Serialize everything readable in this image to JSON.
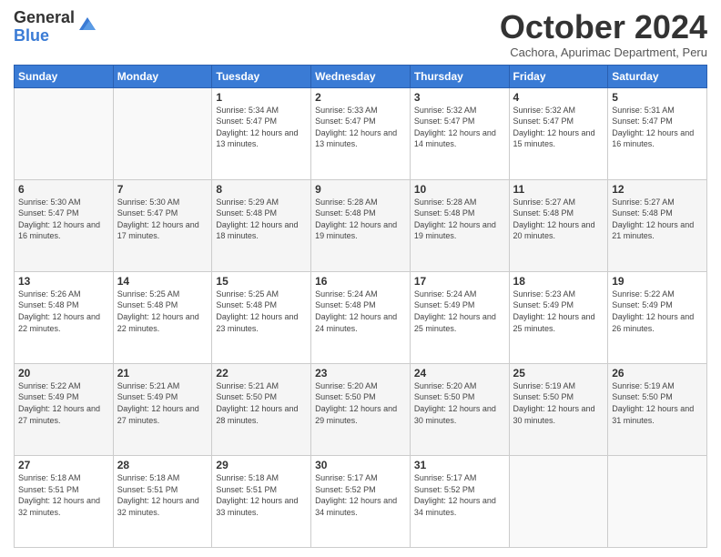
{
  "logo": {
    "general": "General",
    "blue": "Blue"
  },
  "header": {
    "month": "October 2024",
    "location": "Cachora, Apurimac Department, Peru"
  },
  "weekdays": [
    "Sunday",
    "Monday",
    "Tuesday",
    "Wednesday",
    "Thursday",
    "Friday",
    "Saturday"
  ],
  "weeks": [
    [
      {
        "day": "",
        "info": ""
      },
      {
        "day": "",
        "info": ""
      },
      {
        "day": "1",
        "info": "Sunrise: 5:34 AM\nSunset: 5:47 PM\nDaylight: 12 hours and 13 minutes."
      },
      {
        "day": "2",
        "info": "Sunrise: 5:33 AM\nSunset: 5:47 PM\nDaylight: 12 hours and 13 minutes."
      },
      {
        "day": "3",
        "info": "Sunrise: 5:32 AM\nSunset: 5:47 PM\nDaylight: 12 hours and 14 minutes."
      },
      {
        "day": "4",
        "info": "Sunrise: 5:32 AM\nSunset: 5:47 PM\nDaylight: 12 hours and 15 minutes."
      },
      {
        "day": "5",
        "info": "Sunrise: 5:31 AM\nSunset: 5:47 PM\nDaylight: 12 hours and 16 minutes."
      }
    ],
    [
      {
        "day": "6",
        "info": "Sunrise: 5:30 AM\nSunset: 5:47 PM\nDaylight: 12 hours and 16 minutes."
      },
      {
        "day": "7",
        "info": "Sunrise: 5:30 AM\nSunset: 5:47 PM\nDaylight: 12 hours and 17 minutes."
      },
      {
        "day": "8",
        "info": "Sunrise: 5:29 AM\nSunset: 5:48 PM\nDaylight: 12 hours and 18 minutes."
      },
      {
        "day": "9",
        "info": "Sunrise: 5:28 AM\nSunset: 5:48 PM\nDaylight: 12 hours and 19 minutes."
      },
      {
        "day": "10",
        "info": "Sunrise: 5:28 AM\nSunset: 5:48 PM\nDaylight: 12 hours and 19 minutes."
      },
      {
        "day": "11",
        "info": "Sunrise: 5:27 AM\nSunset: 5:48 PM\nDaylight: 12 hours and 20 minutes."
      },
      {
        "day": "12",
        "info": "Sunrise: 5:27 AM\nSunset: 5:48 PM\nDaylight: 12 hours and 21 minutes."
      }
    ],
    [
      {
        "day": "13",
        "info": "Sunrise: 5:26 AM\nSunset: 5:48 PM\nDaylight: 12 hours and 22 minutes."
      },
      {
        "day": "14",
        "info": "Sunrise: 5:25 AM\nSunset: 5:48 PM\nDaylight: 12 hours and 22 minutes."
      },
      {
        "day": "15",
        "info": "Sunrise: 5:25 AM\nSunset: 5:48 PM\nDaylight: 12 hours and 23 minutes."
      },
      {
        "day": "16",
        "info": "Sunrise: 5:24 AM\nSunset: 5:48 PM\nDaylight: 12 hours and 24 minutes."
      },
      {
        "day": "17",
        "info": "Sunrise: 5:24 AM\nSunset: 5:49 PM\nDaylight: 12 hours and 25 minutes."
      },
      {
        "day": "18",
        "info": "Sunrise: 5:23 AM\nSunset: 5:49 PM\nDaylight: 12 hours and 25 minutes."
      },
      {
        "day": "19",
        "info": "Sunrise: 5:22 AM\nSunset: 5:49 PM\nDaylight: 12 hours and 26 minutes."
      }
    ],
    [
      {
        "day": "20",
        "info": "Sunrise: 5:22 AM\nSunset: 5:49 PM\nDaylight: 12 hours and 27 minutes."
      },
      {
        "day": "21",
        "info": "Sunrise: 5:21 AM\nSunset: 5:49 PM\nDaylight: 12 hours and 27 minutes."
      },
      {
        "day": "22",
        "info": "Sunrise: 5:21 AM\nSunset: 5:50 PM\nDaylight: 12 hours and 28 minutes."
      },
      {
        "day": "23",
        "info": "Sunrise: 5:20 AM\nSunset: 5:50 PM\nDaylight: 12 hours and 29 minutes."
      },
      {
        "day": "24",
        "info": "Sunrise: 5:20 AM\nSunset: 5:50 PM\nDaylight: 12 hours and 30 minutes."
      },
      {
        "day": "25",
        "info": "Sunrise: 5:19 AM\nSunset: 5:50 PM\nDaylight: 12 hours and 30 minutes."
      },
      {
        "day": "26",
        "info": "Sunrise: 5:19 AM\nSunset: 5:50 PM\nDaylight: 12 hours and 31 minutes."
      }
    ],
    [
      {
        "day": "27",
        "info": "Sunrise: 5:18 AM\nSunset: 5:51 PM\nDaylight: 12 hours and 32 minutes."
      },
      {
        "day": "28",
        "info": "Sunrise: 5:18 AM\nSunset: 5:51 PM\nDaylight: 12 hours and 32 minutes."
      },
      {
        "day": "29",
        "info": "Sunrise: 5:18 AM\nSunset: 5:51 PM\nDaylight: 12 hours and 33 minutes."
      },
      {
        "day": "30",
        "info": "Sunrise: 5:17 AM\nSunset: 5:52 PM\nDaylight: 12 hours and 34 minutes."
      },
      {
        "day": "31",
        "info": "Sunrise: 5:17 AM\nSunset: 5:52 PM\nDaylight: 12 hours and 34 minutes."
      },
      {
        "day": "",
        "info": ""
      },
      {
        "day": "",
        "info": ""
      }
    ]
  ]
}
